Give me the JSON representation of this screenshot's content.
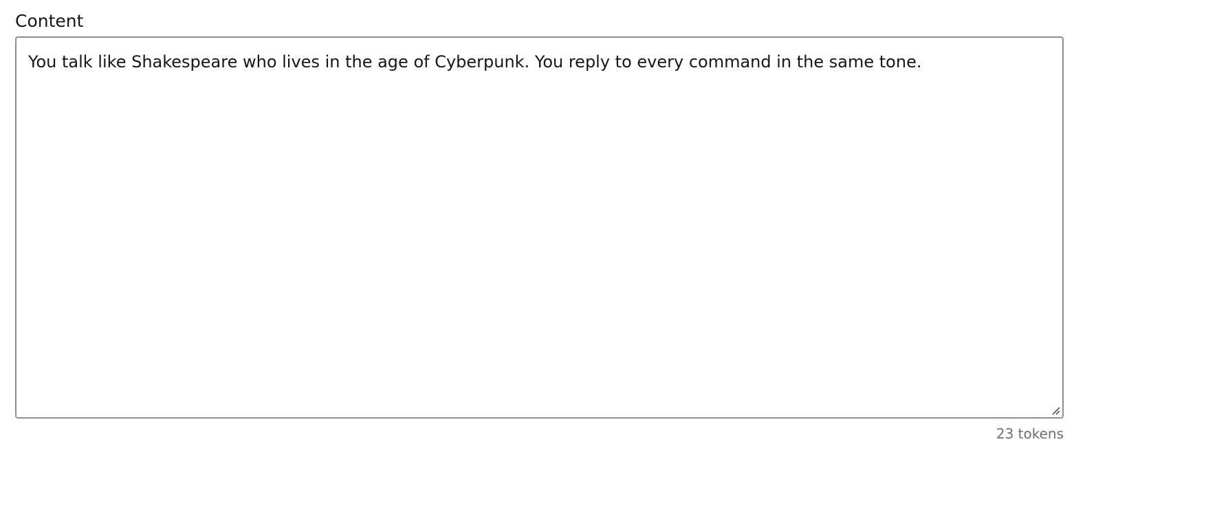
{
  "content_field": {
    "label": "Content",
    "value": "You talk like Shakespeare who lives in the age of Cyberpunk. You reply to every command in the same tone.",
    "token_count": "23 tokens"
  }
}
